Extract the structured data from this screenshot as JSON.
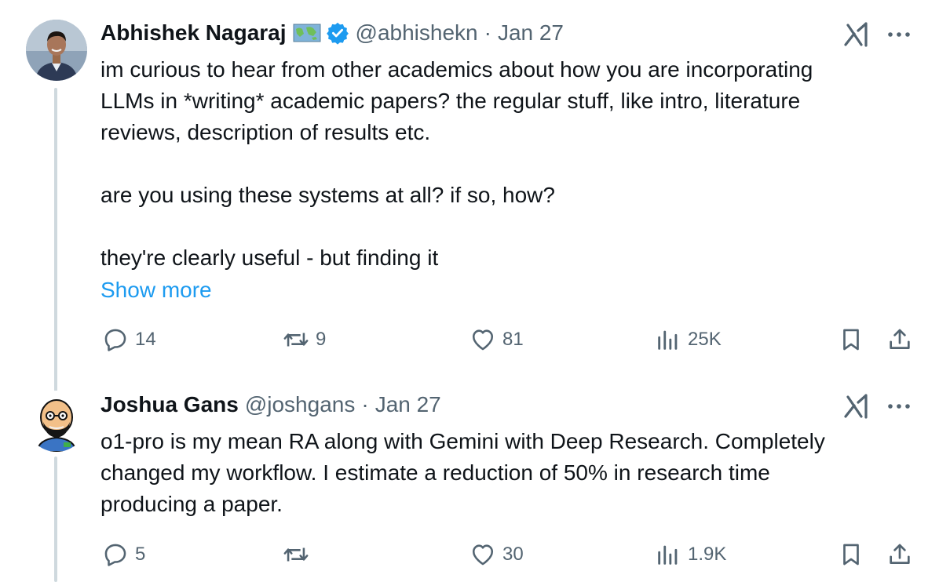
{
  "tweets": [
    {
      "name": "Abhishek Nagaraj",
      "handle": "@abhishekn",
      "separator": "·",
      "date": "Jan 27",
      "text": "im curious to hear from other academics about how you are incorporating\nLLMs in *writing* academic papers? the regular stuff, like intro, literature\nreviews, description of results etc.\n\nare you using these systems at all? if so, how?\n\nthey're clearly useful - but finding it",
      "show_more": "Show more",
      "replies": "14",
      "reposts": "9",
      "likes": "81",
      "views": "25K"
    },
    {
      "name": "Joshua Gans",
      "handle": "@joshgans",
      "separator": "·",
      "date": "Jan 27",
      "text": "o1-pro is my mean RA along with Gemini with Deep Research. Completely\nchanged my workflow. I estimate a reduction of 50% in research time\nproducing a paper.",
      "replies": "5",
      "reposts": "",
      "likes": "30",
      "views": "1.9K"
    }
  ],
  "colors": {
    "accent": "#1d9bf0",
    "muted": "#536471",
    "text": "#0f1419",
    "line": "#cfd9de"
  }
}
